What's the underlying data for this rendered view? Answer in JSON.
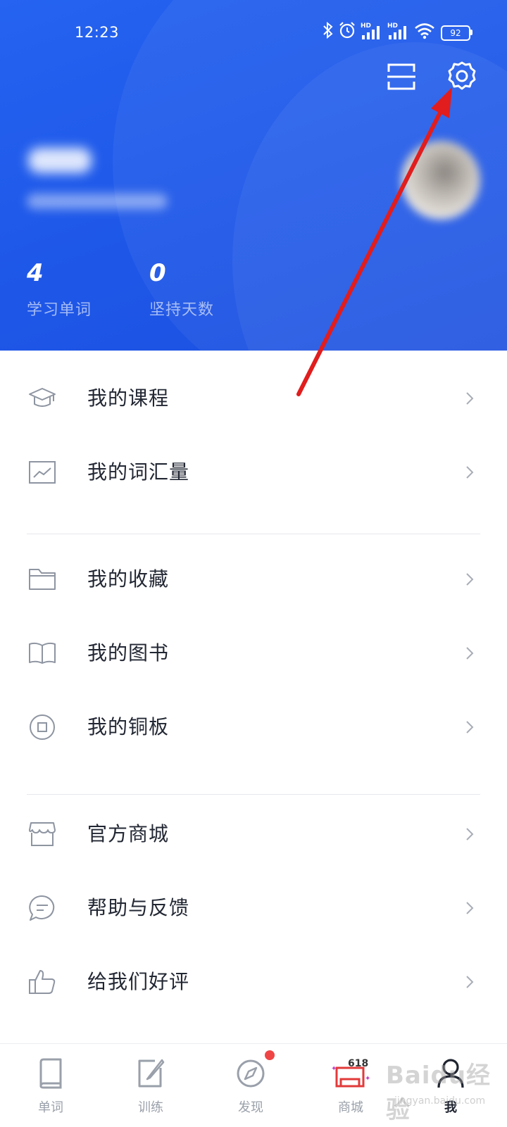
{
  "status_bar": {
    "time": "12:23",
    "battery": "92",
    "icons": [
      "bluetooth-icon",
      "alarm-icon",
      "signal-hd-icon",
      "signal-hd-icon",
      "wifi-icon",
      "battery-icon"
    ]
  },
  "header": {
    "scan_icon": "scan-icon",
    "settings_icon": "gear-icon",
    "stats": [
      {
        "value": "4",
        "label": "学习单词"
      },
      {
        "value": "0",
        "label": "坚持天数"
      }
    ]
  },
  "menu": {
    "groups": [
      [
        {
          "label": "我的课程",
          "icon": "graduation-cap-icon"
        },
        {
          "label": "我的词汇量",
          "icon": "chart-icon"
        }
      ],
      [
        {
          "label": "我的收藏",
          "icon": "folder-icon"
        },
        {
          "label": "我的图书",
          "icon": "book-icon"
        },
        {
          "label": "我的铜板",
          "icon": "coin-icon"
        }
      ],
      [
        {
          "label": "官方商城",
          "icon": "store-icon"
        },
        {
          "label": "帮助与反馈",
          "icon": "chat-icon"
        },
        {
          "label": "给我们好评",
          "icon": "thumbs-up-icon"
        }
      ]
    ]
  },
  "tabbar": {
    "items": [
      {
        "label": "单词",
        "icon": "book-icon",
        "active": false
      },
      {
        "label": "训练",
        "icon": "edit-icon",
        "active": false
      },
      {
        "label": "发现",
        "icon": "compass-icon",
        "active": false,
        "badge": true
      },
      {
        "label": "商城",
        "icon": "shop-618-icon",
        "active": false,
        "promo_text": "618"
      },
      {
        "label": "我",
        "icon": "person-icon",
        "active": true
      }
    ]
  },
  "watermark": {
    "text": "Baidu经验",
    "sub": "jingyan.baidu.com"
  },
  "colors": {
    "header_blue": "#1f5ae8",
    "annotation_red": "#e11d1d",
    "badge_red": "#f04545"
  }
}
